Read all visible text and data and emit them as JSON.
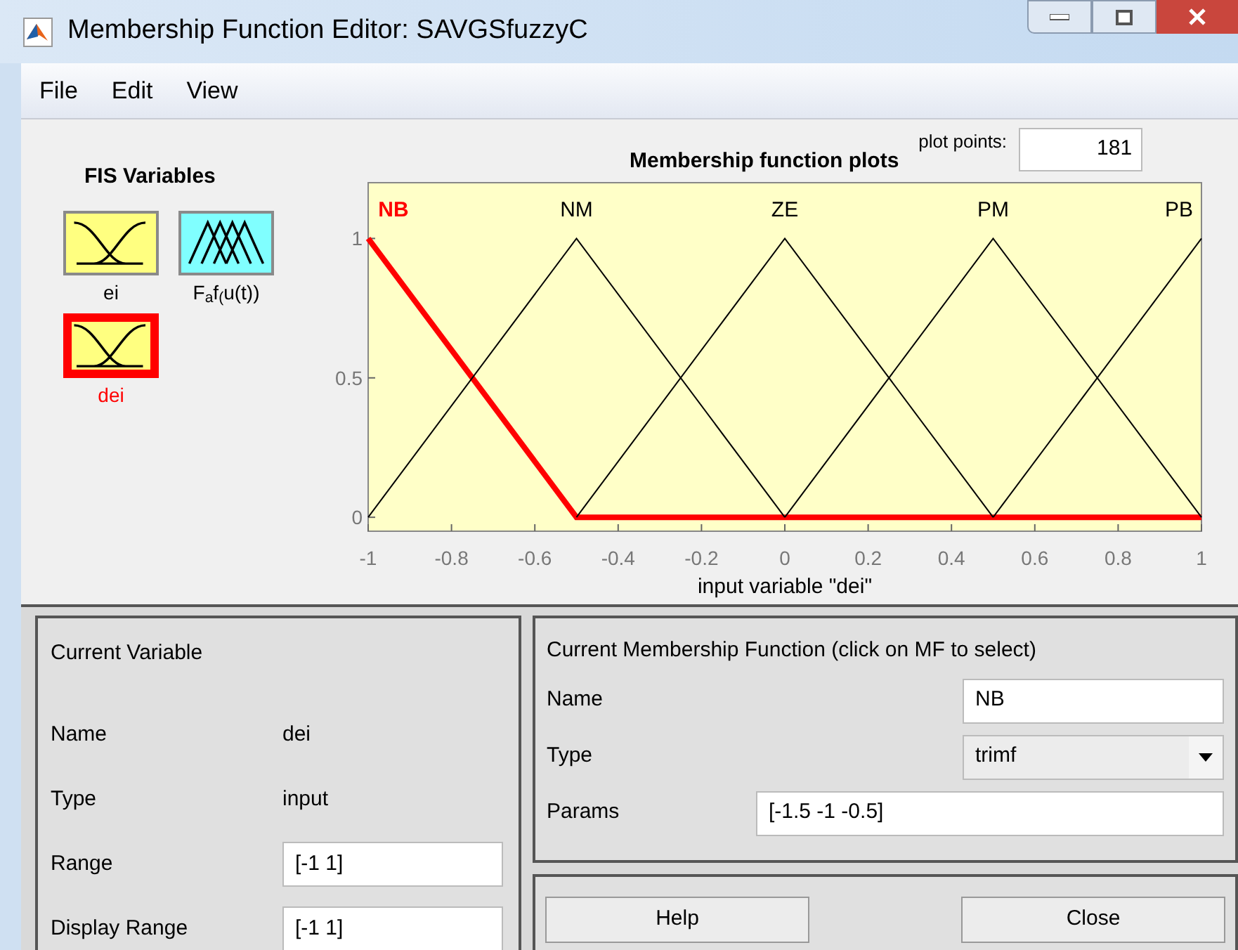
{
  "window": {
    "title": "Membership Function Editor: SAVGSfuzzyC"
  },
  "menu": [
    "File",
    "Edit",
    "View"
  ],
  "fis_variables": {
    "title": "FIS Variables",
    "items": [
      {
        "label": "ei",
        "kind": "input",
        "selected": false
      },
      {
        "label": "F$_{a}$f$_{(}$u(t))",
        "kind": "output",
        "selected": false
      },
      {
        "label": "dei",
        "kind": "input",
        "selected": true
      }
    ]
  },
  "plot": {
    "plot_points_label": "plot points:",
    "plot_points": "181",
    "chart_data": {
      "type": "line",
      "title": "Membership function plots",
      "xlabel": "input variable \"dei\"",
      "x": [
        -1,
        -0.5,
        0,
        0.5,
        1
      ],
      "xlim": [
        -1,
        1
      ],
      "ylim": [
        -0.05,
        1.2
      ],
      "xticks": [
        -1,
        -0.8,
        -0.6,
        -0.4,
        -0.2,
        0,
        0.2,
        0.4,
        0.6,
        0.8,
        1
      ],
      "yticks": [
        0,
        0.5,
        1
      ],
      "series": [
        {
          "name": "NB",
          "color": "#ff0000",
          "values": [
            1,
            0,
            0,
            0,
            0
          ]
        },
        {
          "name": "NM",
          "color": "#000000",
          "values": [
            0,
            1,
            0,
            null,
            null
          ]
        },
        {
          "name": "ZE",
          "color": "#000000",
          "values": [
            null,
            0,
            1,
            0,
            null
          ]
        },
        {
          "name": "PM",
          "color": "#000000",
          "values": [
            null,
            null,
            0,
            1,
            0
          ]
        },
        {
          "name": "PB",
          "color": "#000000",
          "values": [
            null,
            null,
            null,
            0,
            1
          ]
        }
      ]
    }
  },
  "current_variable": {
    "title": "Current Variable",
    "name_label": "Name",
    "name": "dei",
    "type_label": "Type",
    "type": "input",
    "range_label": "Range",
    "range": "[-1 1]",
    "display_range_label": "Display Range",
    "display_range": "[-1 1]"
  },
  "current_mf": {
    "title": "Current Membership Function (click on MF to select)",
    "name_label": "Name",
    "name": "NB",
    "type_label": "Type",
    "type": "trimf",
    "params_label": "Params",
    "params": "[-1.5 -1 -0.5]"
  },
  "buttons": [
    "Help",
    "Close"
  ]
}
